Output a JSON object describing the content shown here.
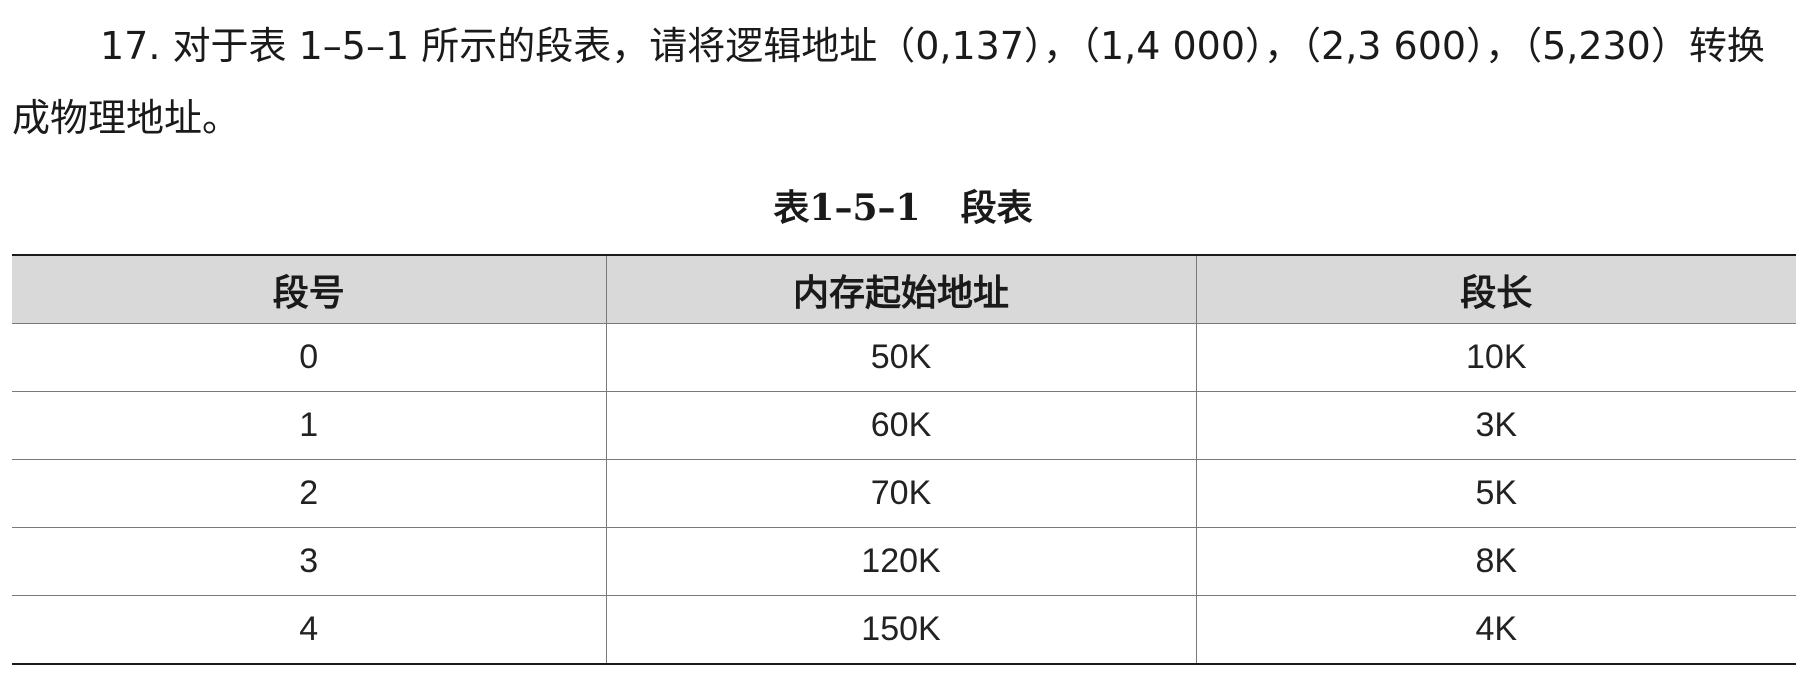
{
  "question": {
    "text": "17. 对于表 1–5–1 所示的段表，请将逻辑地址（0,137），（1,4 000），（2,3 600），（5,230）转换成物理地址。"
  },
  "table": {
    "caption_number": "表1–5–1",
    "caption_title": "段表",
    "headers": [
      "段号",
      "内存起始地址",
      "段长"
    ],
    "rows": [
      [
        "0",
        "50K",
        "10K"
      ],
      [
        "1",
        "60K",
        "3K"
      ],
      [
        "2",
        "70K",
        "5K"
      ],
      [
        "3",
        "120K",
        "8K"
      ],
      [
        "4",
        "150K",
        "4K"
      ]
    ]
  }
}
